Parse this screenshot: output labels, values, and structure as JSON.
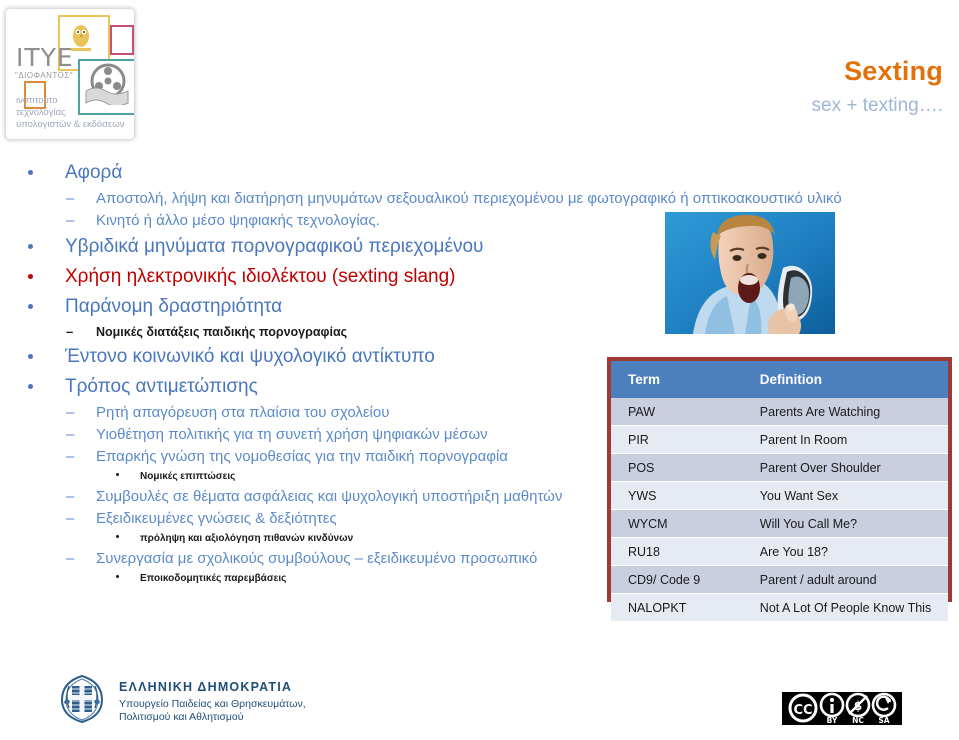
{
  "logo": {
    "brand": "ITYE",
    "brand_sub": "\"ΔΙΟΦΑΝΤΟΣ\"",
    "line1": "ινστιτούτο",
    "line2": "τεχνολογίας",
    "line3": "υπολογιστών & εκδόσεων"
  },
  "title": "Sexting",
  "subtitle": "sex + texting….",
  "photo_alt": "shocked-woman-looking-at-mobile-phone",
  "bullets": [
    {
      "level": 1,
      "text": "Αφορά",
      "color": "blue"
    },
    {
      "level": 2,
      "text": "Αποστολή, λήψη και διατήρηση μηνυμάτων σεξουαλικού περιεχομένου με φωτογραφικό ή οπτικοακουστικό υλικό",
      "color": "blue",
      "justify": true
    },
    {
      "level": 2,
      "text": "Κινητό ή άλλο μέσο ψηφιακής τεχνολογίας.",
      "color": "blue"
    },
    {
      "level": 1,
      "text": "Υβριδικά μηνύματα πορνογραφικού περιεχομένου",
      "color": "blue"
    },
    {
      "level": 1,
      "text": "Χρήση ηλεκτρονικής ιδιολέκτου (sexting slang)",
      "color": "red"
    },
    {
      "level": 1,
      "text": "Παράνομη δραστηριότητα",
      "color": "blue"
    },
    {
      "level": 2,
      "text": "Νομικές διατάξεις παιδικής πορνογραφίας",
      "color": "dark"
    },
    {
      "level": 1,
      "text": "Έντονο κοινωνικό και ψυχολογικό αντίκτυπο",
      "color": "blue"
    },
    {
      "level": 1,
      "text": "Τρόπος αντιμετώπισης",
      "color": "blue"
    },
    {
      "level": 2,
      "text": "Ρητή απαγόρευση στα πλαίσια του σχολείου",
      "color": "blue"
    },
    {
      "level": 2,
      "text": "Υιοθέτηση πολιτικής για τη συνετή χρήση ψηφιακών μέσων",
      "color": "blue"
    },
    {
      "level": 2,
      "text": "Επαρκής γνώση της νομοθεσίας για την παιδική πορνογραφία",
      "color": "blue"
    },
    {
      "level": 3,
      "text": "Νομικές επιπτώσεις",
      "color": "dark"
    },
    {
      "level": 2,
      "text": "Συμβουλές σε θέματα ασφάλειας και ψυχολογική υποστήριξη μαθητών",
      "color": "blue"
    },
    {
      "level": 2,
      "text": "Εξειδικευμένες γνώσεις & δεξιότητες",
      "color": "blue"
    },
    {
      "level": 3,
      "text": "πρόληψη και αξιολόγηση πιθανών κινδύνων",
      "color": "dark"
    },
    {
      "level": 2,
      "text": "Συνεργασία με σχολικούς συμβούλους – εξειδικευμένο προσωπικό",
      "color": "blue"
    },
    {
      "level": 3,
      "text": "Εποικοδομητικές  παρεμβάσεις",
      "color": "dark"
    }
  ],
  "slang_table": {
    "headers": [
      "Term",
      "Definition"
    ],
    "rows": [
      [
        "PAW",
        "Parents Are Watching"
      ],
      [
        "PIR",
        "Parent In Room"
      ],
      [
        "POS",
        "Parent Over Shoulder"
      ],
      [
        "YWS",
        "You Want Sex"
      ],
      [
        "WYCM",
        "Will You Call Me?"
      ],
      [
        "RU18",
        "Are You 18?"
      ],
      [
        "CD9/ Code 9",
        "Parent / adult around"
      ],
      [
        "NALOPKT",
        "Not A Lot Of People Know This"
      ]
    ]
  },
  "footer": {
    "gov_line1": "ΕΛΛΗΝΙΚΗ ΔΗΜΟΚΡΑΤΙΑ",
    "gov_line2": "Υπουργείο Παιδείας και Θρησκευμάτων,",
    "gov_line3": "Πολιτισμού και Αθλητισμού",
    "cc_labels": [
      "BY",
      "NC",
      "SA"
    ],
    "cc_mark": "CC"
  },
  "colors": {
    "title_orange": "#E2700B",
    "subtitle_blue": "#9FB6D4",
    "bullet_blue": "#4A77BC",
    "bullet_red": "#C00000",
    "table_header": "#4C7FBE",
    "table_border": "#9E3A33",
    "row_odd": "#C9CFDF",
    "row_even": "#E6EAF2",
    "gov_blue": "#1F4E79"
  }
}
